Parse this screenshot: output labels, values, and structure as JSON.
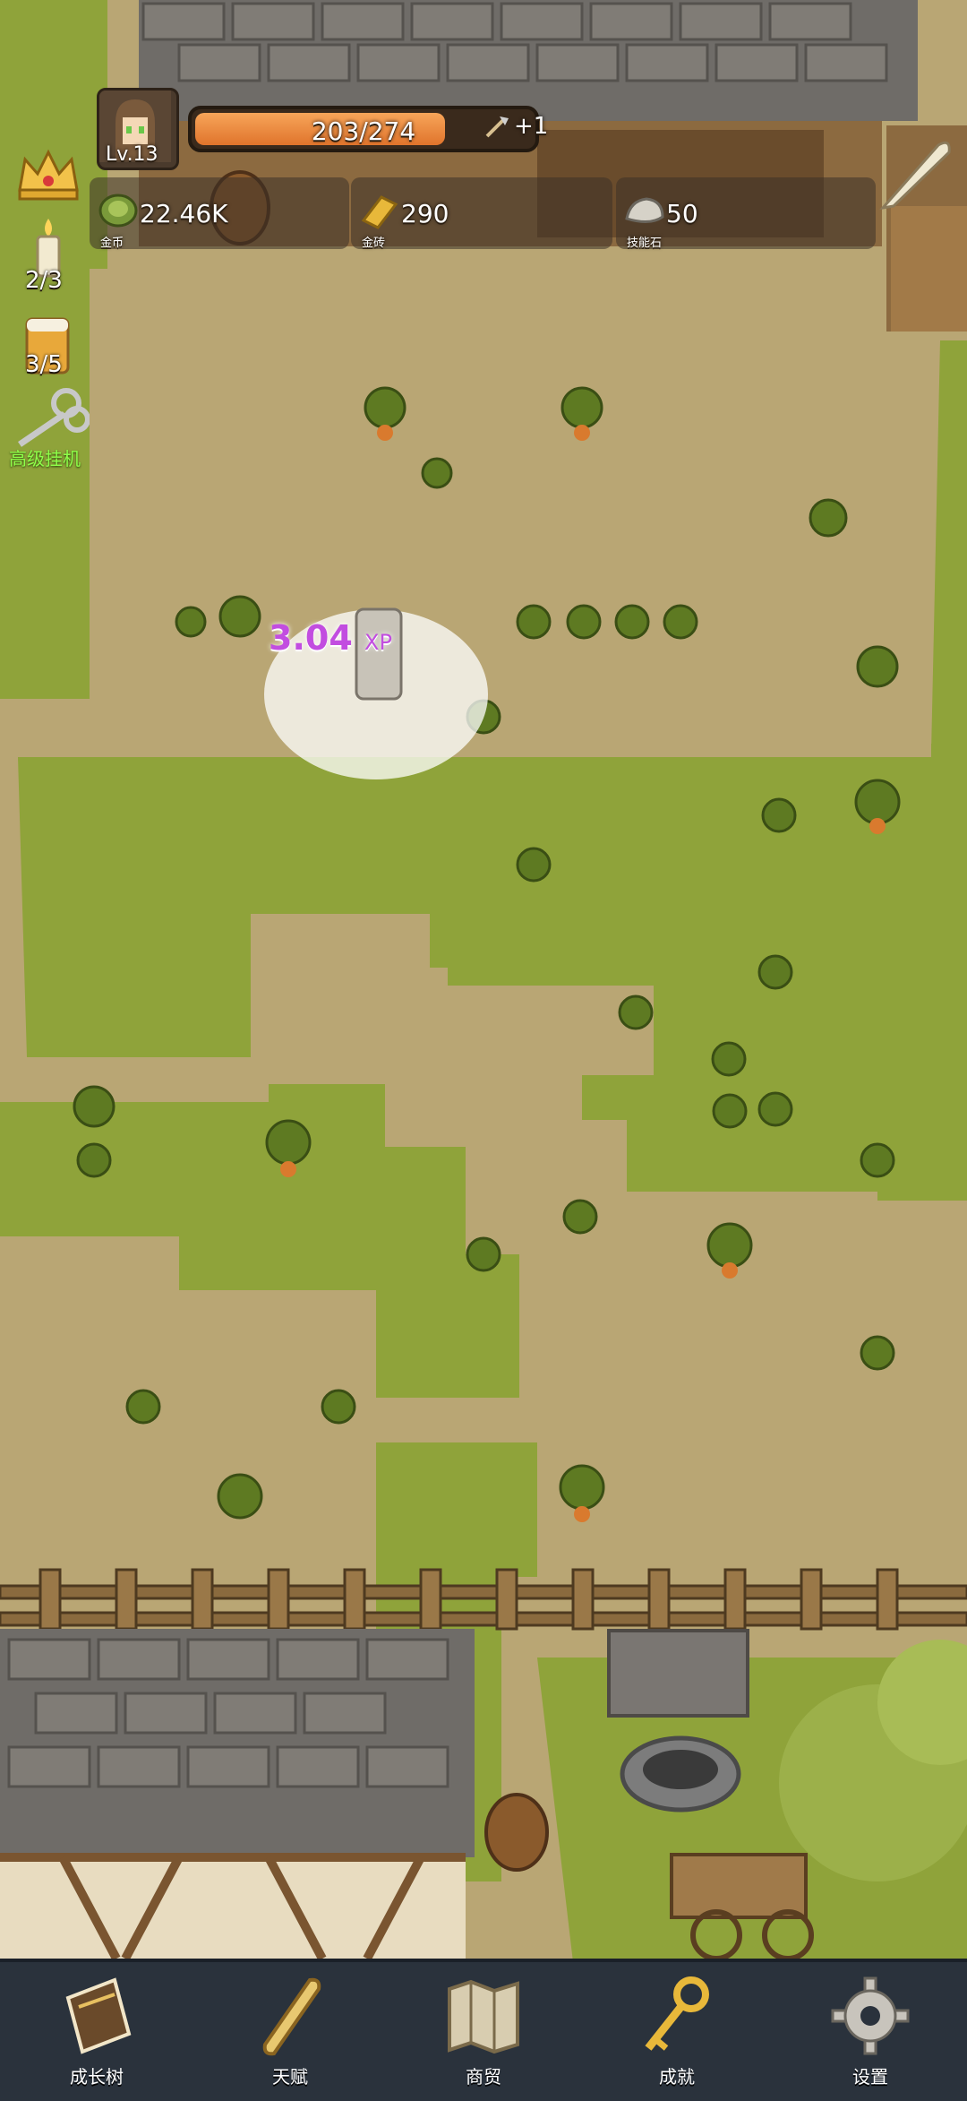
{
  "player": {
    "level": "Lv.13"
  },
  "xp": {
    "current": 203,
    "max": 274,
    "text": "203/274",
    "fraction": 0.741,
    "bonus": "+1"
  },
  "resources": [
    {
      "label": "金币",
      "value": "22.46K",
      "icon": "gold-coin-icon"
    },
    {
      "label": "金砖",
      "value": "290",
      "icon": "gold-bar-icon"
    },
    {
      "label": "技能石",
      "value": "50",
      "icon": "skill-stone-icon"
    }
  ],
  "side": {
    "crown_icon": "crown-icon",
    "candle_count": "2/3",
    "beer_count": "3/5",
    "auto_idle_label": "高级挂机"
  },
  "popup": {
    "value": "3.04",
    "unit": "XP"
  },
  "nav": [
    {
      "label": "成长树",
      "icon": "book-icon"
    },
    {
      "label": "天赋",
      "icon": "scroll-icon"
    },
    {
      "label": "商贸",
      "icon": "map-icon"
    },
    {
      "label": "成就",
      "icon": "key-icon"
    },
    {
      "label": "设置",
      "icon": "gear-icon"
    }
  ],
  "colors": {
    "grass": "#8fa33a",
    "dirt": "#b8a574",
    "xp_fill": "#e8823a",
    "nav_bg": "#2a323c"
  }
}
